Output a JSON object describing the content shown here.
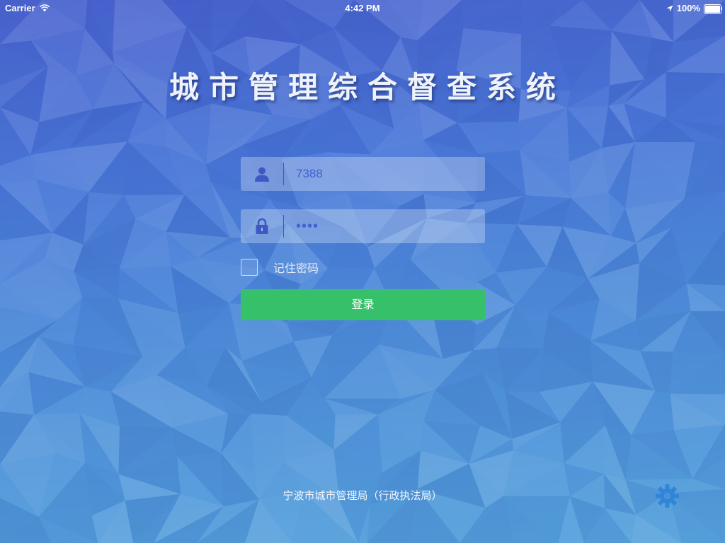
{
  "status_bar": {
    "carrier": "Carrier",
    "time": "4:42 PM",
    "battery": "100%",
    "battery_level": 1.0
  },
  "app": {
    "title": "城市管理综合督查系统"
  },
  "login_form": {
    "username": {
      "value": "7388",
      "icon": "user-icon"
    },
    "password": {
      "value": "••••",
      "icon": "lock-icon"
    },
    "remember": {
      "label": "记住密码",
      "checked": false
    },
    "submit_label": "登录"
  },
  "footer": {
    "organization": "宁波市城市管理局（行政执法局）"
  },
  "settings": {
    "icon": "gear-icon"
  },
  "colors": {
    "background_top": "#4a63cf",
    "background_bottom": "#56a3dc",
    "accent_icon": "#3f58c4",
    "input_text": "#4361cf",
    "button": "#37c06a",
    "gear": "#2f86d8"
  }
}
